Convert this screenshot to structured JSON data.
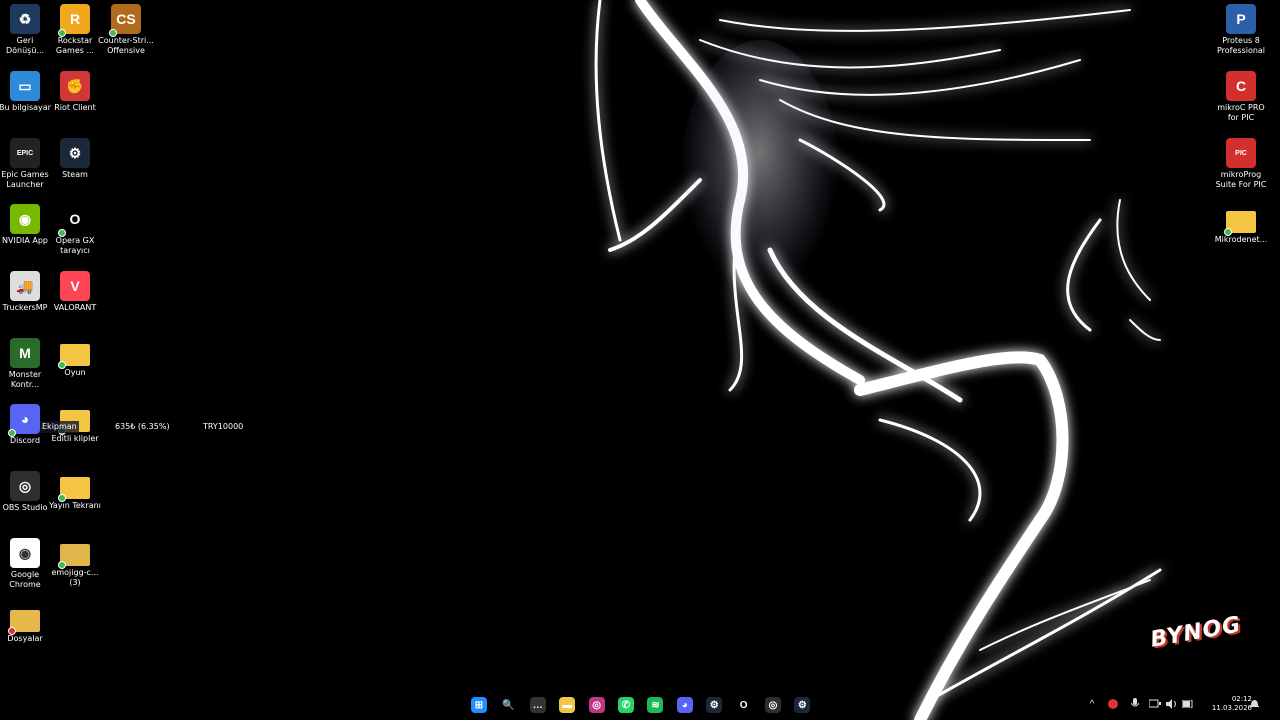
{
  "desktop_left": [
    {
      "label": "Geri Dönüşü...",
      "icon": "recycle-bin-icon",
      "bg": "#1f3a5f",
      "glyph": "♻"
    },
    {
      "label": "Rockstar Games ...",
      "icon": "rockstar-icon",
      "bg": "#f0a81c",
      "glyph": "R"
    },
    {
      "label": "Counter-Stri... Offensive",
      "icon": "csgo-icon",
      "bg": "#b06b1c",
      "glyph": "CS"
    },
    {
      "label": "Bu bilgisayar",
      "icon": "this-pc-icon",
      "bg": "#2c8ad8",
      "glyph": "▭"
    },
    {
      "label": "Riot Client",
      "icon": "riot-client-icon",
      "bg": "#d13639",
      "glyph": "✊"
    },
    {
      "label": "Epic Games Launcher",
      "icon": "epic-games-icon",
      "bg": "#222",
      "glyph": "EPIC"
    },
    {
      "label": "Steam",
      "icon": "steam-icon",
      "bg": "#1b2838",
      "glyph": "⚙"
    },
    {
      "label": "NVIDIA App",
      "icon": "nvidia-icon",
      "bg": "#76b900",
      "glyph": "◉"
    },
    {
      "label": "Opera GX tarayıcı",
      "icon": "opera-gx-icon",
      "bg": "#000",
      "glyph": "O"
    },
    {
      "label": "TruckersMP",
      "icon": "truckersmp-icon",
      "bg": "#ddd",
      "glyph": "🚚"
    },
    {
      "label": "VALORANT",
      "icon": "valorant-icon",
      "bg": "#fd4556",
      "glyph": "V"
    },
    {
      "label": "Monster Kontr...",
      "icon": "monster-icon",
      "bg": "#2a6b2a",
      "glyph": "M"
    },
    {
      "label": "Oyun",
      "icon": "folder-icon",
      "bg": "#f4c542",
      "glyph": ""
    },
    {
      "label": "Discord",
      "icon": "discord-icon",
      "bg": "#5865f2",
      "glyph": "◕"
    },
    {
      "label": "Editli klipler",
      "icon": "folder-icon",
      "bg": "#f4c542",
      "glyph": ""
    },
    {
      "label": "OBS Studio",
      "icon": "obs-icon",
      "bg": "#302e31",
      "glyph": "◎"
    },
    {
      "label": "Yayın Tekranı",
      "icon": "folder-icon",
      "bg": "#f4c542",
      "glyph": ""
    },
    {
      "label": "Google Chrome",
      "icon": "chrome-icon",
      "bg": "#fff",
      "glyph": "◉"
    },
    {
      "label": "emojigg-c... (3)",
      "icon": "folder-icon",
      "bg": "#e0b64a",
      "glyph": ""
    },
    {
      "label": "Dosyalar",
      "icon": "folder-icon",
      "bg": "#e6b84a",
      "glyph": ""
    }
  ],
  "desktop_right": [
    {
      "label": "Proteus 8 Professional",
      "icon": "proteus-icon",
      "bg": "#2b5fa8",
      "glyph": "P"
    },
    {
      "label": "mikroC PRO for PIC",
      "icon": "mikroc-icon",
      "bg": "#d32f2f",
      "glyph": "C"
    },
    {
      "label": "mikroProg Suite For PIC",
      "icon": "mikroprog-icon",
      "bg": "#d32f2f",
      "glyph": "PIC"
    },
    {
      "label": "Mikrodenet...",
      "icon": "folder-icon",
      "bg": "#f4c542",
      "glyph": ""
    }
  ],
  "overlay": {
    "name": "Ekipman",
    "percent": "635₺ (6.35%)",
    "currency": "TRY10000"
  },
  "taskbar": {
    "apps": [
      {
        "name": "start-button",
        "icon": "windows-icon",
        "bg": "#1e90ff",
        "glyph": "⊞"
      },
      {
        "name": "search-button",
        "icon": "search-icon",
        "bg": "transparent",
        "glyph": "🔍"
      },
      {
        "name": "taskbar-app-1",
        "icon": "app-icon",
        "bg": "#333",
        "glyph": "…"
      },
      {
        "name": "taskbar-file-explorer",
        "icon": "file-explorer-icon",
        "bg": "#f4c542",
        "glyph": "▬"
      },
      {
        "name": "taskbar-instagram",
        "icon": "instagram-icon",
        "bg": "#c13584",
        "glyph": "◎"
      },
      {
        "name": "taskbar-whatsapp",
        "icon": "whatsapp-icon",
        "bg": "#25d366",
        "glyph": "✆"
      },
      {
        "name": "taskbar-spotify",
        "icon": "spotify-icon",
        "bg": "#1db954",
        "glyph": "≋"
      },
      {
        "name": "taskbar-discord",
        "icon": "discord-icon",
        "bg": "#5865f2",
        "glyph": "◕"
      },
      {
        "name": "taskbar-steam",
        "icon": "steam-icon",
        "bg": "#1b2838",
        "glyph": "⚙"
      },
      {
        "name": "taskbar-opera-gx",
        "icon": "opera-gx-icon",
        "bg": "#000",
        "glyph": "O"
      },
      {
        "name": "taskbar-obs",
        "icon": "obs-icon",
        "bg": "#302e31",
        "glyph": "◎"
      },
      {
        "name": "taskbar-steam-2",
        "icon": "steam-icon",
        "bg": "#1b2838",
        "glyph": "⚙"
      }
    ],
    "tray": {
      "chevron": "^",
      "time": "02:12",
      "date": "11.03.2026"
    }
  },
  "logo": "BYNOG"
}
